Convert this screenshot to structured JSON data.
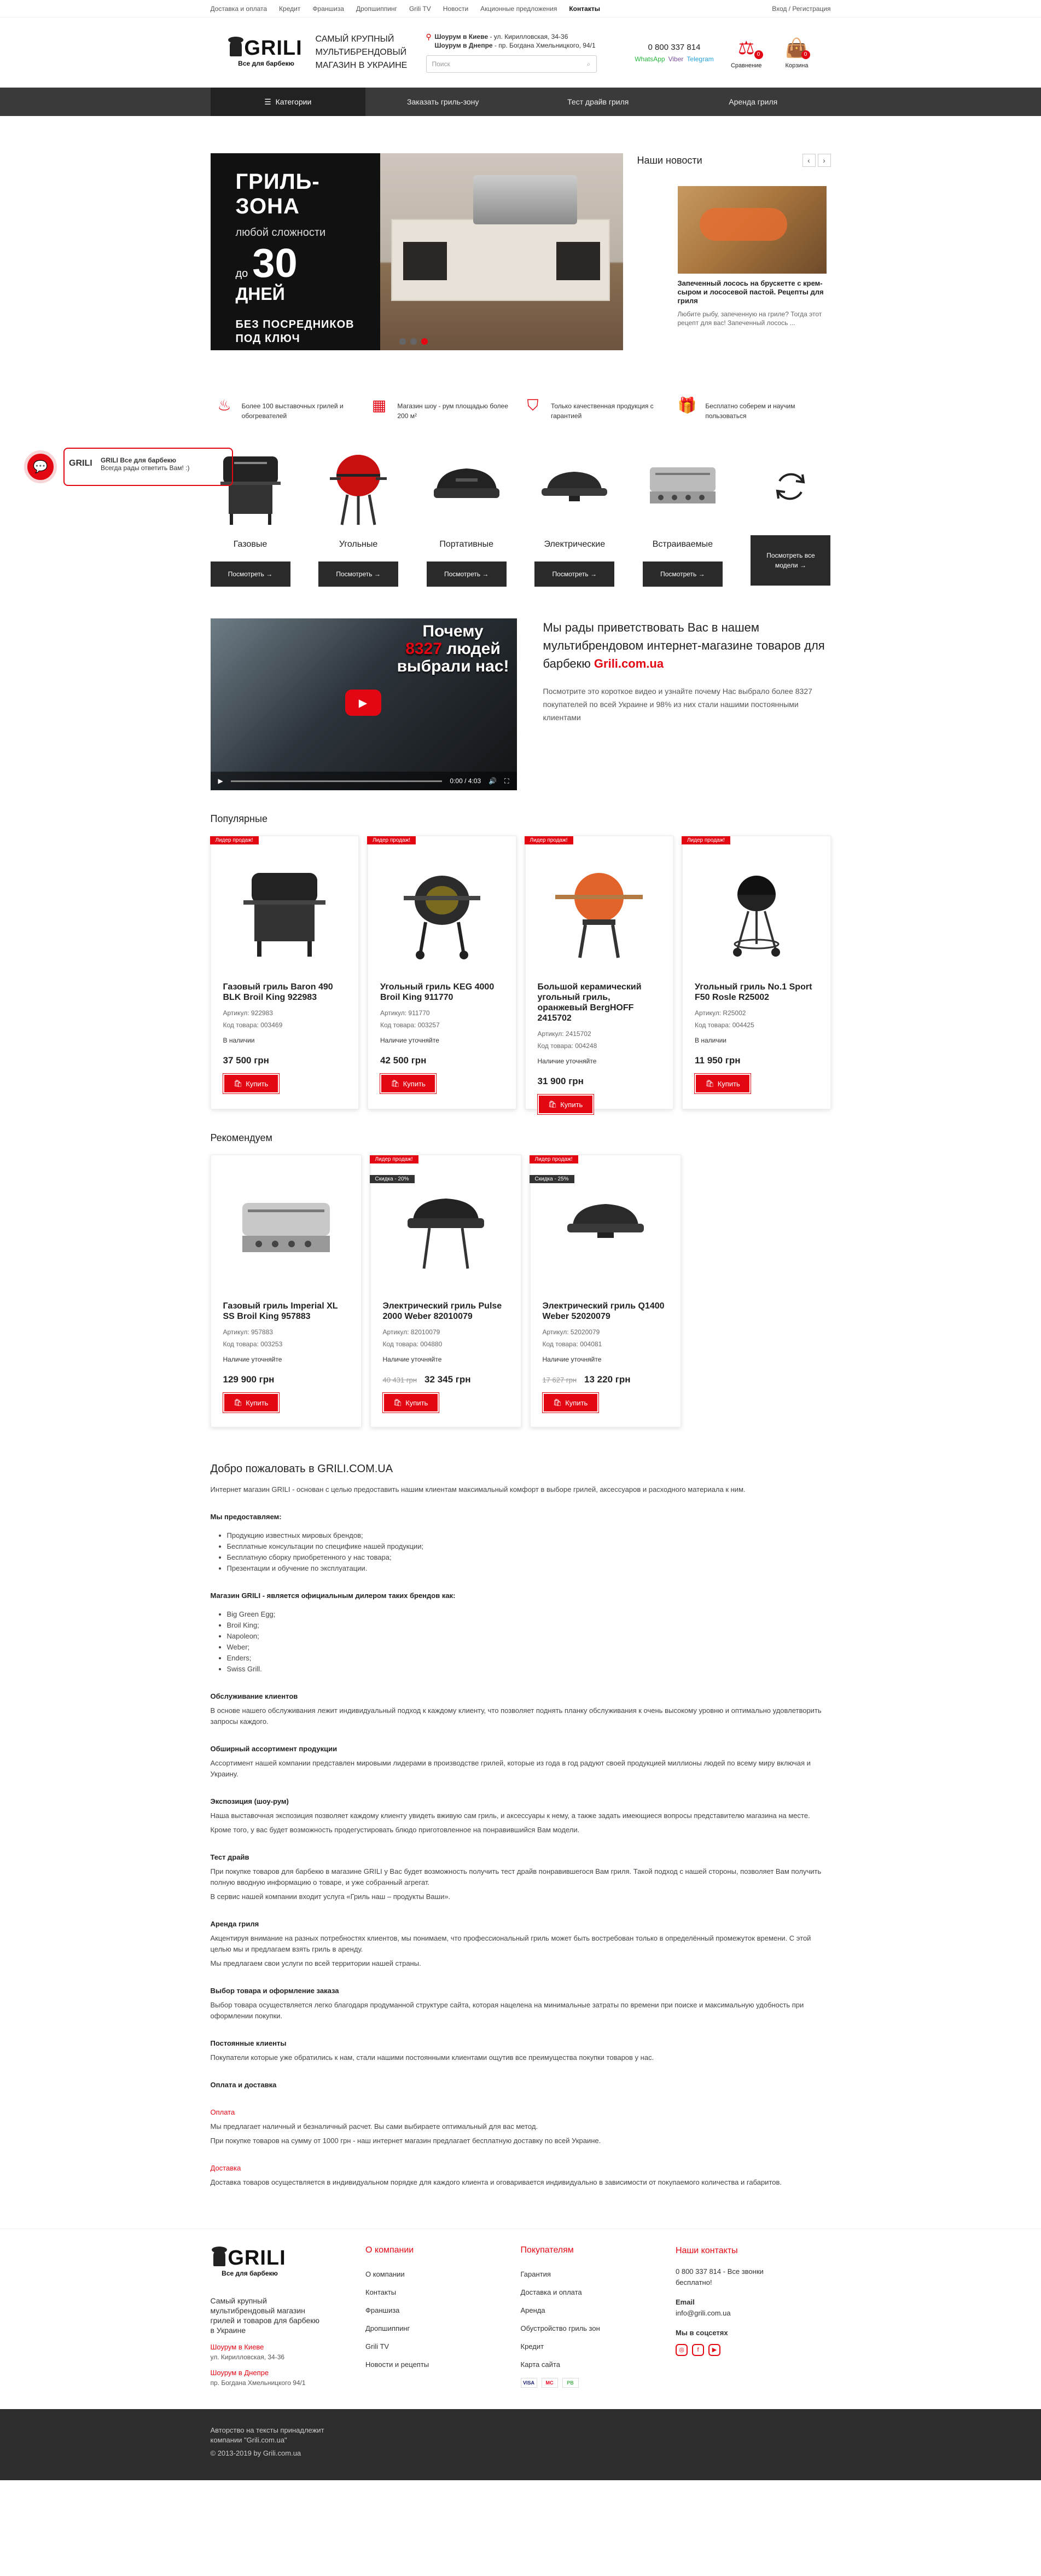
{
  "topbar": {
    "links": [
      "Доставка и оплата",
      "Кредит",
      "Франшиза",
      "Дропшиппинг",
      "Grili TV",
      "Новости",
      "Акционные предложения",
      "Контакты"
    ],
    "login": "Вход / Регистрация"
  },
  "header": {
    "logo_text": "GRILI",
    "logo_sub": "Все для барбекю",
    "tagline": "САМЫЙ КРУПНЫЙ МУЛЬТИБРЕНДОВЫЙ МАГАЗИН В УКРАИНЕ",
    "showroom_kiev_label": "Шоурум в Киеве",
    "showroom_kiev": " - ул. Кирилловская, 34-36",
    "showroom_dnepr_label": "Шоурум в Днепре",
    "showroom_dnepr": " - пр. Богдана Хмельницкого, 94/1",
    "search_placeholder": "Поиск",
    "phone": "0 800 337 814",
    "whatsapp": "WhatsApp",
    "viber": "Viber",
    "telegram": "Telegram",
    "compare_label": "Сравнение",
    "compare_count": "0",
    "cart_label": "Корзина",
    "cart_count": "0"
  },
  "nav": {
    "categories": "Категории",
    "items": [
      "Заказать гриль-зону",
      "Тест драйв гриля",
      "Аренда гриля"
    ]
  },
  "slider": {
    "title": "ГРИЛЬ-ЗОНА",
    "subtitle": "любой сложности",
    "do": "до",
    "number": "30",
    "days": "ДНЕЙ",
    "footer": "БЕЗ ПОСРЕДНИКОВ ПОД КЛЮЧ"
  },
  "news": {
    "title": "Наши новости",
    "card_title": "Запеченный лосось на брускетте с крем-сыром и лососевой пастой. Рецепты для гриля",
    "card_text": "Любите рыбу, запеченную на гриле? Тогда этот рецепт для вас! Запеченный лосось ..."
  },
  "features": [
    {
      "icon": "grill-icon",
      "text": "Более 100 выставочных грилей и обогревателей"
    },
    {
      "icon": "store-icon",
      "text": "Магазин шоу - рум площадью более 200 м²"
    },
    {
      "icon": "shield-icon",
      "text": "Только качественная продукция с гарантией"
    },
    {
      "icon": "gift-icon",
      "text": "Бесплатно соберем и научим пользоваться"
    }
  ],
  "categories": [
    {
      "name": "Газовые",
      "button": "Посмотреть →"
    },
    {
      "name": "Угольные",
      "button": "Посмотреть →"
    },
    {
      "name": "Портативные",
      "button": "Посмотреть →"
    },
    {
      "name": "Электрические",
      "button": "Посмотреть →"
    },
    {
      "name": "Встраиваемые",
      "button": "Посмотреть →"
    }
  ],
  "all_models": "Посмотреть все модели →",
  "chat": {
    "title": "GRILI Все для барбекю",
    "text": "Всегда рады ответить Вам! :)",
    "logo": "GRILI"
  },
  "video": {
    "line1": "Почему",
    "line2": "8327",
    "line2b": "людей",
    "line3": "выбрали нас!",
    "time": "0:00 / 4:03"
  },
  "about": {
    "heading": "Мы рады приветствовать Вас в нашем мультибрендовом интернет-магазине товаров для барбекю",
    "brand": "Grili.com.ua",
    "text": "Посмотрите это короткое видео и узнайте почему Нас выбрало более 8327 покупателей по всей Украине и 98% из них стали нашими постоянными клиентами"
  },
  "popular": {
    "title": "Популярные",
    "items": [
      {
        "ribbon": "Лидер продаж!",
        "name": "Газовый гриль Baron 490 BLK Broil King 922983",
        "sku": "Артикул: 922983",
        "code": "Код товара: 003469",
        "avail": "В наличии",
        "price": "37 500 грн",
        "buy": "Купить"
      },
      {
        "ribbon": "Лидер продаж!",
        "name": "Угольный гриль KEG 4000 Broil King 911770",
        "sku": "Артикул: 911770",
        "code": "Код товара: 003257",
        "avail": "Наличие уточняйте",
        "price": "42 500 грн",
        "buy": "Купить"
      },
      {
        "ribbon": "Лидер продаж!",
        "name": "Большой керамический угольный гриль, оранжевый BergHOFF 2415702",
        "sku": "Артикул: 2415702",
        "code": "Код товара: 004248",
        "avail": "Наличие уточняйте",
        "price": "31 900 грн",
        "buy": "Купить"
      },
      {
        "ribbon": "Лидер продаж!",
        "name": "Угольный гриль No.1 Sport F50 Rosle R25002",
        "sku": "Артикул: R25002",
        "code": "Код товара: 004425",
        "avail": "В наличии",
        "price": "11 950 грн",
        "buy": "Купить"
      }
    ]
  },
  "recommended": {
    "title": "Рекомендуем",
    "items": [
      {
        "ribbon": "",
        "sale": "",
        "name": "Газовый гриль Imperial XL SS Broil King 957883",
        "sku": "Артикул: 957883",
        "code": "Код товара: 003253",
        "avail": "Наличие уточняйте",
        "old_price": "",
        "price": "129 900 грн",
        "buy": "Купить"
      },
      {
        "ribbon": "Лидер продаж!",
        "sale": "Скидка - 20%",
        "name": "Электрический гриль Pulse 2000 Weber 82010079",
        "sku": "Артикул: 82010079",
        "code": "Код товара: 004880",
        "avail": "Наличие уточняйте",
        "old_price": "40 431 грн",
        "price": "32 345 грн",
        "buy": "Купить"
      },
      {
        "ribbon": "Лидер продаж!",
        "sale": "Скидка - 25%",
        "name": "Электрический гриль Q1400 Weber 52020079",
        "sku": "Артикул: 52020079",
        "code": "Код товара: 004081",
        "avail": "Наличие уточняйте",
        "old_price": "17 627 грн",
        "price": "13 220 грн",
        "buy": "Купить"
      }
    ]
  },
  "seo": {
    "title": "Добро пожаловать в GRILI.COM.UA",
    "intro": "Интернет магазин GRILI - основан с целью предоставить нашим клиентам максимальный комфорт в выборе грилей, аксессуаров и расходного материала к ним.",
    "offer_head": "Мы предоставляем:",
    "offer": [
      "Продукцию известных мировых брендов;",
      "Бесплатные консультации по специфике нашей продукции;",
      "Бесплатную сборку приобретенного у нас товара;",
      "Презентации и обучение по эксплуатации."
    ],
    "dealer_head": "Магазин GRILI - является официальным дилером таких брендов как:",
    "brands": [
      "Big Green Egg;",
      "Broil King;",
      "Napoleon;",
      "Weber;",
      "Enders;",
      "Swiss Grill."
    ],
    "s1_head": "Обслуживание клиентов",
    "s1": "В основе нашего обслуживания лежит индивидуальный подход к каждому клиенту, что позволяет поднять планку обслуживания к очень высокому уровню и оптимально удовлетворить запросы каждого.",
    "s2_head": "Обширный ассортимент продукции",
    "s2": "Ассортимент нашей компании представлен мировыми лидерами в производстве грилей, которые из года в год радуют своей продукцией миллионы людей по всему миру включая и Украину.",
    "s3_head": "Экспозиция (шоу-рум)",
    "s3a": "Наша выставочная экспозиция позволяет каждому клиенту увидеть вживую сам гриль, и аксессуары к нему, а также задать имеющиеся вопросы представителю магазина на месте.",
    "s3b": "Кроме того, у вас будет возможность продегустировать блюдо приготовленное на понравившийся Вам модели.",
    "s4_head": "Тест драйв",
    "s4a": "При покупке товаров для барбекю в магазине GRILI у Вас будет возможность получить тест драйв понравившегося Вам гриля. Такой подход с нашей стороны, позволяет Вам получить полную вводную информацию о товаре, и уже собранный агрегат.",
    "s4b": "В сервис нашей компании входит услуга «Гриль наш – продукты Ваши».",
    "s5_head": "Аренда гриля",
    "s5a": "Акцентируя внимание на разных потребностях клиентов, мы понимаем, что профессиональный гриль может быть востребован только в определённый промежуток времени. С этой целью мы и предлагаем взять гриль в аренду.",
    "s5b": "Мы предлагаем свои услуги по всей территории нашей страны.",
    "s6_head": "Выбор товара и оформление заказа",
    "s6": "Выбор товара осуществляется легко благодаря продуманной структуре сайта, которая нацелена на минимальные затраты по времени при поиске и максимальную удобность при оформлении покупки.",
    "s7_head": "Постоянные клиенты",
    "s7": "Покупатели которые уже обратились к нам, стали нашими постоянными клиентами ощутив все преимущества покупки товаров у нас.",
    "s8_head": "Оплата и доставка",
    "pay_head": "Оплата",
    "pay1": "Мы предлагает наличный и безналичный расчет. Вы сами выбираете оптимальный для вас метод.",
    "pay2": "При покупке товаров на сумму от 1000 грн - наш интернет магазин предлагает бесплатную доставку по всей Украине.",
    "del_head": "Доставка",
    "del": "Доставка товаров осуществляется в индивидуальном порядке для каждого клиента и оговаривается индивидуально в зависимости от покупаемого количества и габаритов."
  },
  "footer": {
    "desc": "Самый крупный мультибрендовый магазин грилей и товаров для барбекю в Украине",
    "kiev_label": "Шоурум в Киеве",
    "kiev": "ул. Кирилловская, 34-36",
    "dnepr_label": "Шоурум в Днепре",
    "dnepr": "пр. Богдана Хмельницкого 94/1",
    "col2_head": "О компании",
    "col2": [
      "О компании",
      "Контакты",
      "Франшиза",
      "Дропшиппинг",
      "Grili TV",
      "Новости и рецепты"
    ],
    "col3_head": "Покупателям",
    "col3": [
      "Гарантия",
      "Доставка и оплата",
      "Аренда",
      "Обустройство гриль зон",
      "Кредит",
      "Карта сайта"
    ],
    "col4_head": "Наши контакты",
    "phone": "0 800 337 814 - Все звонки",
    "free": "бесплатно!",
    "email_label": "Email",
    "email": "info@grili.com.ua",
    "social_label": "Мы в соцсетях",
    "pays": [
      "VISA",
      "MC",
      "PB"
    ]
  },
  "copyright": {
    "line1": "Авторство на тексты принадлежит компании \"Grili.com.ua\"",
    "line2": "© 2013-2019 by Grili.com.ua"
  }
}
